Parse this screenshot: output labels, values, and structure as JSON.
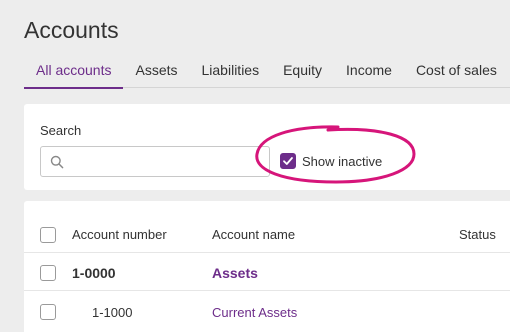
{
  "page": {
    "title": "Accounts"
  },
  "tabs": [
    {
      "label": "All accounts",
      "active": true
    },
    {
      "label": "Assets"
    },
    {
      "label": "Liabilities"
    },
    {
      "label": "Equity"
    },
    {
      "label": "Income"
    },
    {
      "label": "Cost of sales"
    }
  ],
  "search": {
    "label": "Search",
    "value": "",
    "placeholder": ""
  },
  "filters": {
    "show_inactive_label": "Show inactive",
    "show_inactive_checked": true
  },
  "table": {
    "headers": {
      "account_number": "Account number",
      "account_name": "Account name",
      "status": "Status"
    },
    "rows": [
      {
        "account_number": "1-0000",
        "account_name": "Assets"
      },
      {
        "account_number": "1-1000",
        "account_name": "Current Assets"
      }
    ]
  },
  "colors": {
    "accent": "#6d2d8a",
    "highlight": "#d6157a"
  }
}
